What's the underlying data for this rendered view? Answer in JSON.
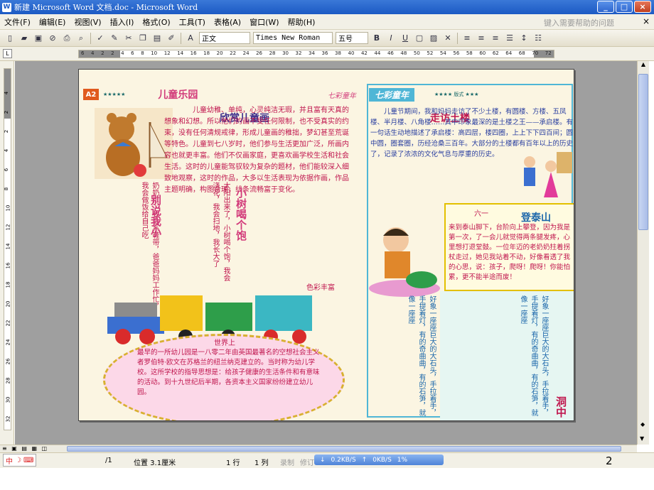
{
  "window": {
    "title": "新建 Microsoft Word 文档.doc - Microsoft Word",
    "buttons": [
      "_",
      "□",
      "×"
    ]
  },
  "menu": {
    "items": [
      "文件(F)",
      "编辑(E)",
      "视图(V)",
      "插入(I)",
      "格式(O)",
      "工具(T)",
      "表格(A)",
      "窗口(W)",
      "帮助(H)"
    ],
    "help_placeholder": "键入需要帮助的问题"
  },
  "toolbar": {
    "style": "正文",
    "font": "Times New Roman",
    "size": "五号",
    "bold": "B",
    "italic": "I",
    "underline": "U"
  },
  "ruler": {
    "numbers": [
      "6",
      "4",
      "2",
      "2",
      "4",
      "6",
      "8",
      "10",
      "12",
      "14",
      "16",
      "18",
      "20",
      "22",
      "24",
      "26",
      "28",
      "30",
      "32",
      "34",
      "36",
      "38",
      "40",
      "42",
      "44",
      "46",
      "48",
      "50",
      "52",
      "54",
      "56",
      "58",
      "60",
      "62",
      "64",
      "68",
      "70",
      "72"
    ],
    "vnumbers": [
      "4",
      "2",
      "2",
      "4",
      "6",
      "8",
      "10",
      "12",
      "14",
      "16",
      "18",
      "20",
      "22",
      "24",
      "26",
      "28",
      "30",
      "32"
    ]
  },
  "newspaper": {
    "badge": "A2",
    "section": "儿童乐园",
    "brand": "七彩童年",
    "right_section": "七彩童年",
    "headline1": "欣赏儿童画",
    "text1": "儿童幼稚、单纯，心灵纯洁无瑕，并且富有天真的想象和幻想。所以他们的画不受任何限制，也不受真实的约束，没有任何清规戒律，形成儿童画的稚拙，梦幻甚至荒诞等特色。儿童到七八岁时，他们参与生活更加广泛，所画内容也就更丰富。他们不仅画家庭，更喜欢画学校生活和社会生活。这时的儿童能驾驭较为复杂的题材，他们能较深入细致地观察，这时的作品，大多以生活表现为依据作画，作品主题明确，构图合理，线条流畅富于变化。",
    "credit": "色彩丰富",
    "vtitle1": "别说我小",
    "vtitle2": "小树喝个饱",
    "vtext1": "奶奶忙，我会系鞋带，爸爸妈妈工作忙，我会做饭给自己吃",
    "vtext2": "太阳出来了，小树喝个饱，我会浇花，我会扫地，我长大了",
    "egg_title": "世界上",
    "egg_text": "最早的一所幼儿园是一八零二年由英国最著名的空想社会主义者罗伯特·欧文在苏格兰的纽兰纳克建立的。当时称为幼儿学校。这所学校的指导思想是：给孩子健康的生活条件和有意味的活动。到十九世纪后半期，各资本主义国家纷纷建立幼儿园。",
    "headline2": "走访土楼",
    "text2": "儿童节期间，我和妈妈走访了不少土楼，有圆楼、方楼、五凤楼、半月楼、八角楼……其中印象最深的是土楼之王——承启楼。有一句话生动地描述了承启楼：高四层，楼四圈，上上下下四百间；圆中圆，圈套圈，历经沧桑三百年。大部分的土楼都有百年以上的历史了，记录了浓浓的文化气息与厚重的历史。",
    "headline3": "登泰山",
    "quote_mark": "六一",
    "text3": "来到泰山脚下，台阶向上攀登，因为我是第一次，了一会儿就觉得两条腿发疼，心里想打退堂鼓。一位年迈的老奶奶拄着拐杖走过，她见我站着不动，好像看透了我的心思，说：孩子，爬呀！爬呀！你能怕累，更不能半途而废！",
    "hand_text": "好象一座座巨大的大石头，手拉着手，手提着灯，有的奇曲曲，有的石笋，就像一座座",
    "cave": "洞中"
  },
  "status": {
    "ime": "中",
    "page": "/1",
    "position": "位置 3.1厘米",
    "line": "1 行",
    "col": "1 列",
    "rec": "录制",
    "rev": "修订",
    "down": "0.2KB/S",
    "up": "0KB/S",
    "pct": "1%",
    "pagenum": "2"
  }
}
